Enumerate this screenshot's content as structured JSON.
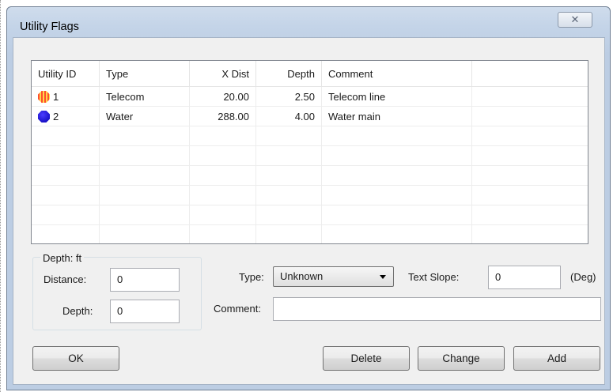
{
  "window": {
    "title": "Utility Flags",
    "close_glyph": "✕"
  },
  "table": {
    "columns": [
      "Utility ID",
      "Type",
      "X Dist",
      "Depth",
      "Comment"
    ],
    "rows": [
      {
        "id": "1",
        "type": "Telecom",
        "x_dist": "20.00",
        "depth": "2.50",
        "comment": "Telecom line",
        "icon": "telecom-flag-icon",
        "icon_color": "#ff5a3c"
      },
      {
        "id": "2",
        "type": "Water",
        "x_dist": "288.00",
        "depth": "4.00",
        "comment": "Water main",
        "icon": "water-flag-icon",
        "icon_color": "#1a12c8"
      }
    ]
  },
  "form": {
    "group_label": "Depth: ft",
    "distance_label": "Distance:",
    "distance_value": "0",
    "depth_label": "Depth:",
    "depth_value": "0",
    "type_label": "Type:",
    "type_selected": "Unknown",
    "text_slope_label": "Text Slope:",
    "text_slope_value": "0",
    "text_slope_unit": "(Deg)",
    "comment_label": "Comment:",
    "comment_value": ""
  },
  "buttons": {
    "ok": "OK",
    "delete": "Delete",
    "change": "Change",
    "add": "Add"
  }
}
